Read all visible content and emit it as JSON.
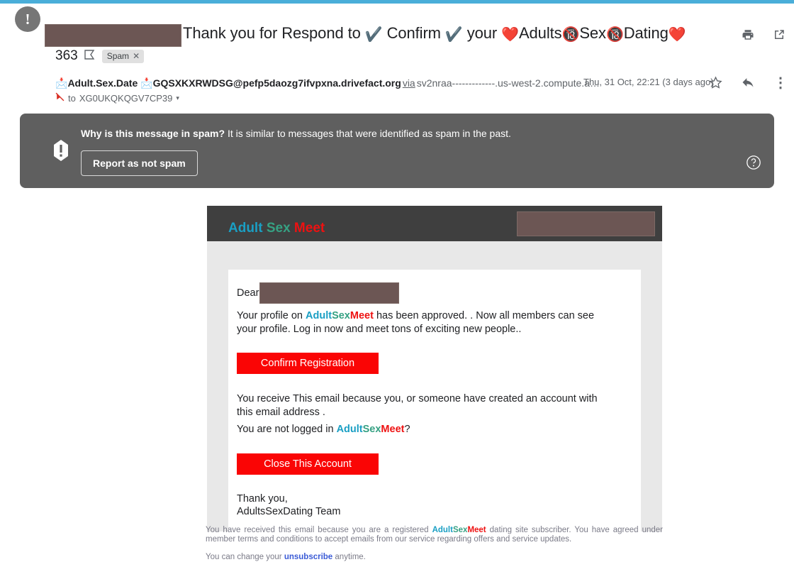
{
  "theme": {
    "accent_bar": "#4aaed9",
    "banner_bg": "#5f5f5f",
    "mail_header_bg": "#3f3f3f",
    "cta_red": "#fa0505",
    "brand_blue": "#1a9fc4",
    "brand_green": "#36a183",
    "brand_red": "#ee1111",
    "redaction": "#6c5654"
  },
  "subject": {
    "text_1": "Thank you for Respond to ",
    "check_1": "✔️",
    "text_2": " Confirm ",
    "check_2": "✔️",
    "text_3": " your ",
    "heart_1": "❤️",
    "text_4": "Adults",
    "badge_1": "🔞",
    "text_5": "Sex",
    "badge_2": "🔞",
    "text_6": "Dating",
    "heart_2": "❤️",
    "thread_count": "363",
    "inbox_glyph": "Ɖ",
    "label_chip": "Spam",
    "label_chip_remove": "✕",
    "print_icon": "print-icon",
    "popout_icon": "open-in-new-icon"
  },
  "sender": {
    "avatar_glyph": "!",
    "envelope_icon": "📩",
    "display_name": "Adult.Sex.Date",
    "email_address": "GQSXKXRWDSG@pefp5daozg7ifvpxna.drivefact.org",
    "via_label": "via",
    "relay_host": "sv2nraa-------------.us-west-2.compute.a…",
    "recipient_prefix": "to",
    "recipient": "XG0UKQKQGV7CP39",
    "recipient_caret": "▾",
    "no_encryption_icon": "no-encryption-icon",
    "date": "Thu, 31 Oct, 22:21 (3 days ago)",
    "star_icon": "☆",
    "reply_icon": "reply-icon",
    "more_icon": "⋮"
  },
  "spam_banner": {
    "alert_icon": "alert-icon",
    "question_bold": "Why is this message in spam?",
    "explanation": " It is similar to messages that were identified as spam in the past.",
    "report_button": "Report as not spam",
    "help_icon": "help-icon"
  },
  "email": {
    "brand": {
      "word_1": "Adult",
      "word_2": "Sex",
      "word_3": "Meet"
    },
    "header_redaction": "redacted-banner",
    "greeting": "Dear",
    "greeting_redaction": "redacted-name",
    "paragraph_1": {
      "before": "Your profile on ",
      "brand_1": "Adult",
      "brand_2": "Sex",
      "brand_3": "Meet",
      "after": " has been approved. . Now all members can see your profile. Log in now and meet tons of exciting new people.."
    },
    "cta_1": "Confirm Registration",
    "paragraph_2_line_1": "You receive This email because you, or someone have created an account with this",
    "paragraph_2_line_2": "email address .",
    "paragraph_3": {
      "before": "You are not logged in ",
      "brand_1": "Adult",
      "brand_2": "Sex",
      "brand_3": "Meet",
      "after": "?"
    },
    "cta_2": "Close This Account",
    "signoff_line_1": "Thank you,",
    "signoff_line_2": "AdultsSexDating Team"
  },
  "footer": {
    "line_1_before": "You have received this email because you are a registered ",
    "brand_1": "Adult",
    "brand_2": "Sex",
    "brand_3": "Meet",
    "line_1_after": " dating site subscriber. You have agreed under member terms and conditions to accept emails from our service regarding offers and service updates.",
    "line_2_before": "You can change your ",
    "unsubscribe": "unsubscribe",
    "line_2_after": " anytime."
  }
}
